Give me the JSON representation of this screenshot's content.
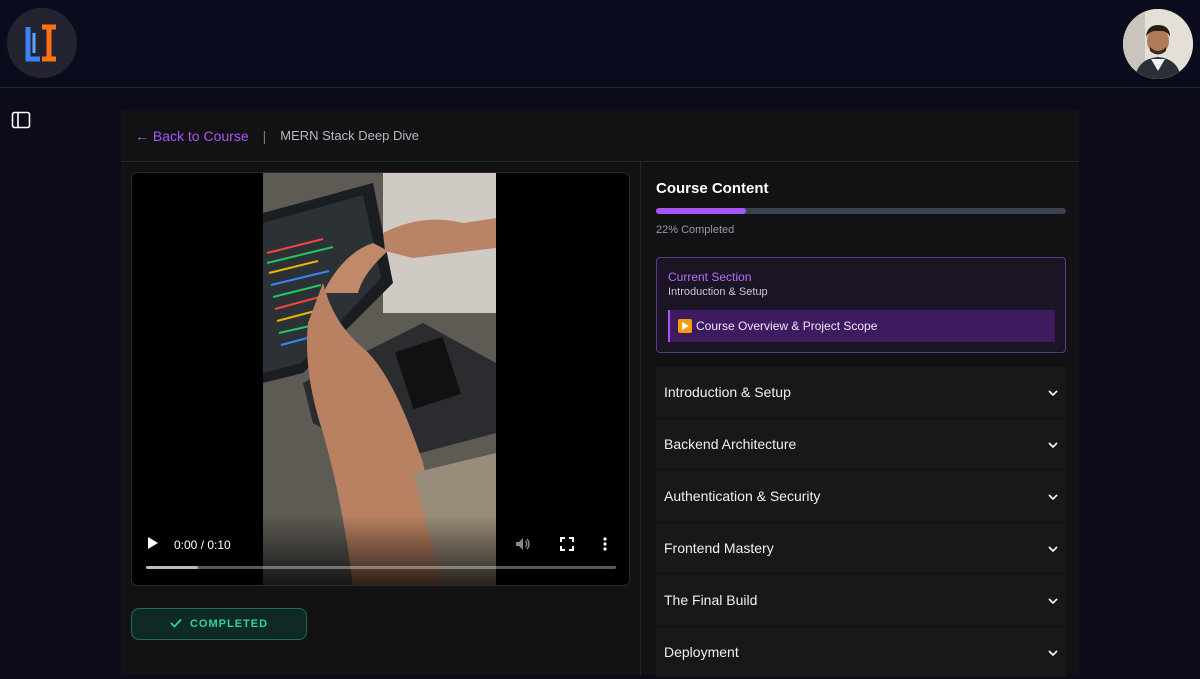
{
  "header": {
    "logo_icon": "brand-logo-icon",
    "avatar_icon": "user-avatar"
  },
  "sidebar_toggle_icon": "sidebar-toggle-icon",
  "breadcrumb": {
    "back_label": "← Back to Course",
    "separator": "|",
    "course_title": "MERN Stack Deep Dive"
  },
  "video": {
    "time": "0:00 / 0:10",
    "progress": 0.0,
    "buffered": 0.11,
    "icons": [
      "play-icon",
      "volume-icon",
      "fullscreen-icon",
      "more-options-icon"
    ]
  },
  "completed_button": {
    "label": "COMPLETED",
    "icon": "check-icon"
  },
  "course_content": {
    "title": "Course Content",
    "progress_percent": 22,
    "progress_label": "22% Completed",
    "current_section": {
      "label": "Current Section",
      "name": "Introduction & Setup",
      "lesson": "Course Overview & Project Scope",
      "lesson_icon": "play-button-icon"
    },
    "sections": [
      {
        "label": "Introduction & Setup"
      },
      {
        "label": "Backend Architecture"
      },
      {
        "label": "Authentication & Security"
      },
      {
        "label": "Frontend Mastery"
      },
      {
        "label": "The Final Build"
      },
      {
        "label": "Deployment"
      }
    ]
  },
  "colors": {
    "accent": "#a855f7",
    "success": "#34d399",
    "background": "#0b0b1a",
    "panel": "#121214"
  }
}
